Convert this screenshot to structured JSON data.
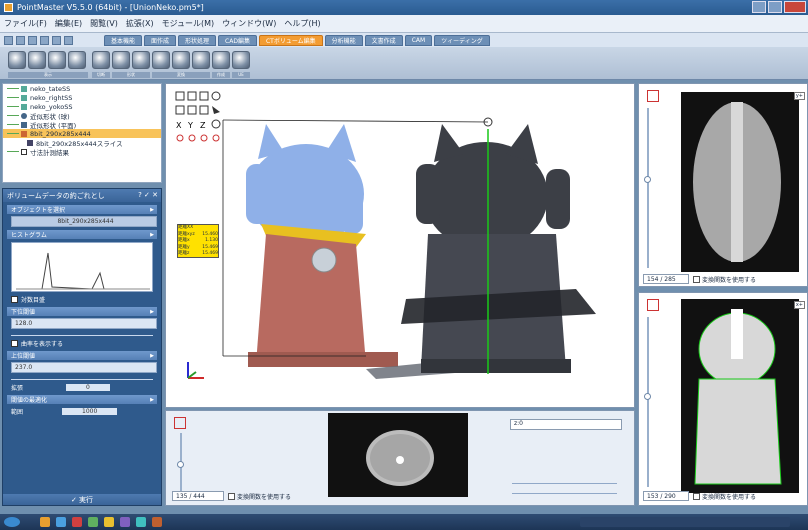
{
  "window": {
    "title": "PointMaster V5.5.0 (64bit) - [UnionNeko.pm5*]"
  },
  "menu": [
    "ファイル(F)",
    "編集(E)",
    "閲覧(V)",
    "拡張(X)",
    "モジュール(M)",
    "ウィンドウ(W)",
    "ヘルプ(H)"
  ],
  "ribbon_tabs": [
    {
      "label": "基本機能",
      "active": false
    },
    {
      "label": "面作成",
      "active": false
    },
    {
      "label": "形状処理",
      "active": false
    },
    {
      "label": "CAD編集",
      "active": false
    },
    {
      "label": "CTボリューム編集",
      "active": true
    },
    {
      "label": "分析機能",
      "active": false
    },
    {
      "label": "文書作成",
      "active": false
    },
    {
      "label": "CAM",
      "active": false
    },
    {
      "label": "ツィーディング",
      "active": false
    }
  ],
  "ribbon_groups": [
    "表示",
    "切断",
    "形状",
    "変換",
    "作成",
    "UE"
  ],
  "tree": [
    {
      "label": "neko_tateSS",
      "indent": 1,
      "selected": false
    },
    {
      "label": "neko_rightSS",
      "indent": 1,
      "selected": false
    },
    {
      "label": "neko_yokoSS",
      "indent": 1,
      "selected": false
    },
    {
      "label": "近似形状 (球)",
      "indent": 1,
      "selected": false
    },
    {
      "label": "近似形状 (平面)",
      "indent": 1,
      "selected": false
    },
    {
      "label": "8bit_290x285x444",
      "indent": 1,
      "selected": true
    },
    {
      "label": "8bit_290x285x444スライス",
      "indent": 2,
      "selected": false
    },
    {
      "label": "寸法計測結果",
      "indent": 1,
      "selected": false
    }
  ],
  "panel": {
    "title": "ボリュームデータの約ごれとし",
    "title_buttons": "? ✓ ✕",
    "sections": {
      "select": "オブジェクトを選択",
      "histogram": "ヒストグラム",
      "lower": "下位閾値",
      "upper": "上位閾値",
      "rate": "閾値の最適化"
    },
    "object_value": "8bit_290x285x444",
    "log_label": "対数目盛",
    "lower_value": "128.0",
    "show_rate_label": "曲率を表示する",
    "upper_value": "237.0",
    "extend_label": "拡張",
    "extend_value": "0",
    "range_label": "範囲",
    "range_value": "1000",
    "execute_label": "✓ 実行"
  },
  "measure_labels": [
    {
      "name": "距離XX",
      "value": ""
    },
    {
      "name": "距離xyz",
      "value": "15.460"
    },
    {
      "name": "距離x",
      "value": "1.130"
    },
    {
      "name": "距離y",
      "value": "15.469"
    },
    {
      "name": "距離z",
      "value": "15.469"
    }
  ],
  "lower_view": {
    "counter": "135 / 444",
    "use_label": "変換関数を使用する",
    "dropdown": "z:0"
  },
  "right_top": {
    "counter": "154 / 285",
    "use_label": "変換関数を使用する",
    "axis": "y+"
  },
  "right_bottom": {
    "counter": "153 / 290",
    "use_label": "変換関数を使用する",
    "axis": "x+"
  },
  "colors": {
    "accent": "#f39c32",
    "panel": "#2f5a8c",
    "cat_blue": "#8fb0e8",
    "cat_dark": "#3c3f46",
    "cat_red": "#b86a60"
  }
}
